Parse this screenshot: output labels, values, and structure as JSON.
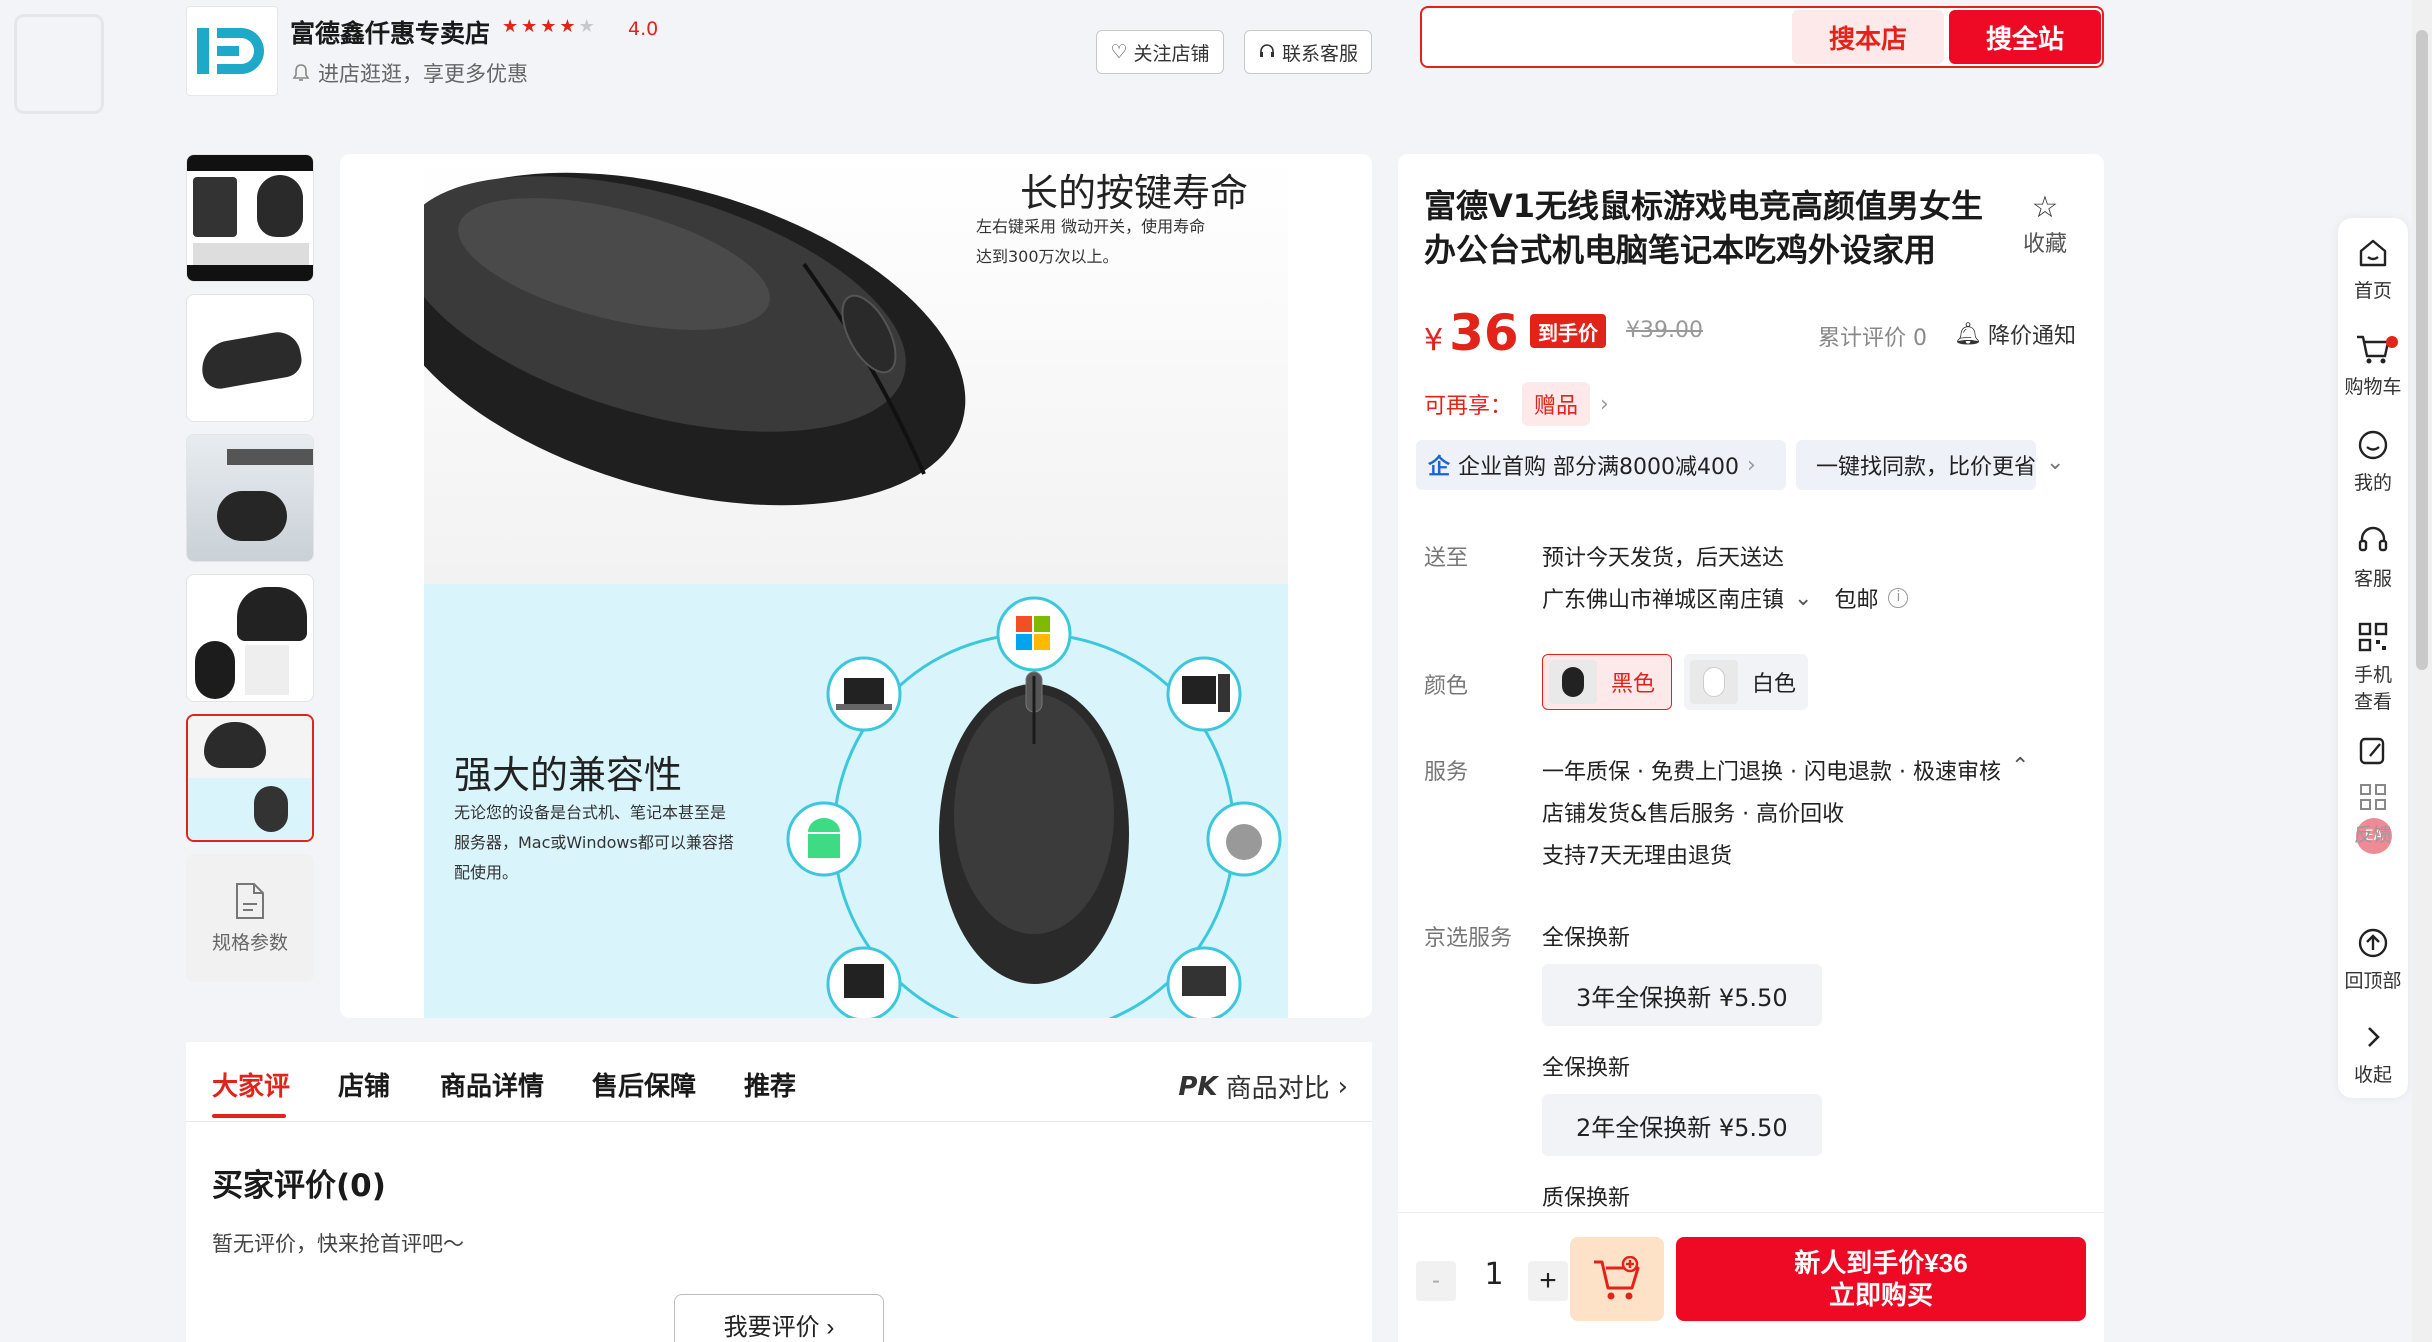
{
  "shop": {
    "name": "富德鑫仟惠专卖店",
    "rating": "4.0",
    "stars_filled": 4,
    "stars_total": 5,
    "subtitle": "进店逛逛，享更多优惠",
    "follow_label": "关注店铺",
    "service_label": "联系客服"
  },
  "search": {
    "placeholder": "",
    "store_button": "搜本店",
    "all_button": "搜全站"
  },
  "gallery": {
    "spec_label": "规格参数",
    "slide1_heading": "长的按键寿命",
    "slide1_text1": "左右键采用        微动开关，使用寿命",
    "slide1_text2": "达到300万次以上。",
    "slide2_heading": "强大的兼容性",
    "slide2_text1": "无论您的设备是台式机、笔记本甚至是",
    "slide2_text2": "服务器，Mac或Windows都可以兼容搭",
    "slide2_text3": "配使用。"
  },
  "tabs": {
    "items": [
      "大家评",
      "店铺",
      "商品详情",
      "售后保障",
      "推荐"
    ],
    "compare_prefix": "PK",
    "compare_label": "商品对比"
  },
  "reviews": {
    "title": "买家评价(0)",
    "empty_text": "暂无评价，快来抢首评吧～",
    "write_button": "我要评价"
  },
  "product": {
    "title": "富德V1无线鼠标游戏电竞高颜值男女生办公台式机电脑笔记本吃鸡外设家用",
    "fav_label": "收藏",
    "currency": "¥",
    "price": "36",
    "price_tag": "到手价",
    "original_price": "¥39.00",
    "review_count": "累计评价 0",
    "price_alert": "降价通知",
    "enjoy_label": "可再享：",
    "gift_label": "赠品",
    "promo1": "企业首购 部分满8000减400",
    "promo2": "一键找同款，比价更省",
    "ship_label": "送至",
    "ship_eta": "预计今天发货，后天送达",
    "address": "广东佛山市禅城区南庄镇",
    "free_ship": "包邮",
    "color_label": "颜色",
    "colors": [
      "黑色",
      "白色"
    ],
    "service_label": "服务",
    "service_line1": "一年质保 · 免费上门退换 · 闪电退款 · 极速审核",
    "service_line2": "店铺发货&售后服务 · 高价回收",
    "service_line3": "支持7天无理由退货",
    "jx_label": "京选服务",
    "jx_group1": "全保换新",
    "jx_option1": "3年全保换新  ¥5.50",
    "jx_group2": "全保换新",
    "jx_option2": "2年全保换新  ¥5.50",
    "jx_group3": "质保换新"
  },
  "buy": {
    "minus": "-",
    "qty": "1",
    "plus": "+",
    "buy_line1": "新人到手价¥36",
    "buy_line2": "立即购买"
  },
  "sidebar": {
    "home": "首页",
    "cart": "购物车",
    "mine": "我的",
    "service": "客服",
    "phone1": "手机",
    "phone2": "查看",
    "feedback": "反馈",
    "top": "回顶部",
    "collapse": "收起"
  },
  "colors": {
    "accent": "#e2231a",
    "buy": "#ee0a24",
    "page_bg": "#f3f4f8"
  }
}
